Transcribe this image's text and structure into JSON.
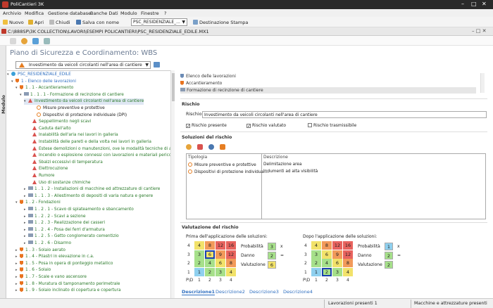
{
  "window": {
    "title": "PoliCantieri 3K",
    "minimize": "–",
    "maximize": "□",
    "close": "✕"
  },
  "menu": [
    "Archivio",
    "Modifica",
    "Gestione database",
    "Banche Dati",
    "Modulo",
    "Finestre",
    "?"
  ],
  "toolbar": {
    "nuovo": "Nuovo",
    "apri": "Apri",
    "chiudi": "Chiudi",
    "salva": "Salva con nome",
    "combo_value": "PSC_RESIDENZIALE_...",
    "stampa": "Destinazione Stampa"
  },
  "path": {
    "text": "C:\\888SP\\3K COLLECTION\\LAVORI\\ESEMPI POLICANTIERI\\PSC_RESIDENZIALE_EDILE.MX1",
    "controls": "– □ ✕"
  },
  "sidebar": {
    "label": "Modulo"
  },
  "page": {
    "title": "Piano di Sicurezza e Coordinamento: WBS"
  },
  "tree_combo": {
    "value": "Investimento da veicoli circolanti nell'area di cantiere"
  },
  "tree": [
    {
      "text": "PSC_RESIDENZIALE_EDILE",
      "color": "blue",
      "icon": "root"
    },
    {
      "text": "1 - Elenco delle lavorazioni",
      "color": "blue",
      "icon": "pin"
    },
    {
      "text": "1 . 1 - Accantieramento",
      "color": "green",
      "icon": "pin"
    },
    {
      "text": "1 . 1 . 1 - Formazione di recinzione di cantiere",
      "color": "green",
      "icon": "folder"
    },
    {
      "text": "Investimento da veicoli circolanti nell'area di cantiere",
      "color": "green",
      "icon": "warn"
    },
    {
      "text": "Misure preventive e protettive",
      "color": "black",
      "icon": "shield"
    },
    {
      "text": "Dispositivi di protezione individuale (DPI)",
      "color": "black",
      "icon": "shield"
    },
    {
      "text": "Seppellimento negli scavi",
      "color": "green",
      "icon": "warn"
    },
    {
      "text": "Caduta dall'alto",
      "color": "green",
      "icon": "warn"
    },
    {
      "text": "Inalabilità dell'aria nei lavori in galleria",
      "color": "green",
      "icon": "warn"
    },
    {
      "text": "Instabilità delle pareti e della volta nei lavori in galleria",
      "color": "green",
      "icon": "warn"
    },
    {
      "text": "Estese demolizioni o manutenzioni, ove le modalità tecniche di atti",
      "color": "green",
      "icon": "warn"
    },
    {
      "text": "Incendio o esplosione connessi con lavorazioni e materiali pericolo",
      "color": "green",
      "icon": "warn"
    },
    {
      "text": "Sbalzi eccessivi di temperatura",
      "color": "green",
      "icon": "warn"
    },
    {
      "text": "Elettrocuzione",
      "color": "green",
      "icon": "warn"
    },
    {
      "text": "Rumore",
      "color": "green",
      "icon": "warn"
    },
    {
      "text": "Uso di sostanze chimiche",
      "color": "green",
      "icon": "warn"
    },
    {
      "text": "1 . 1 . 2 - Installazioni di macchine ed attrezzature di cantiere",
      "color": "green",
      "icon": "folder"
    },
    {
      "text": "1 . 1 . 3 - Allestimento di depositi di varia natura e genere",
      "color": "green",
      "icon": "folder"
    },
    {
      "text": "1 . 2 - Fondazioni",
      "color": "green",
      "icon": "pin"
    },
    {
      "text": "1 . 2 . 1 - Scavo di splateamento e sbancamento",
      "color": "green",
      "icon": "folder"
    },
    {
      "text": "1 . 2 . 2 - Scavi a sezione",
      "color": "green",
      "icon": "folder"
    },
    {
      "text": "1 . 2 . 3 - Realizzazione dei casseri",
      "color": "green",
      "icon": "folder"
    },
    {
      "text": "1 . 2 . 4 - Posa dei ferri d'armatura",
      "color": "green",
      "icon": "folder"
    },
    {
      "text": "1 . 2 . 5 - Getto conglomerato cementizio",
      "color": "green",
      "icon": "folder"
    },
    {
      "text": "1 . 2 . 6 - Disarmo",
      "color": "green",
      "icon": "folder"
    },
    {
      "text": "1 . 3 - Solaio aerato",
      "color": "green",
      "icon": "pin"
    },
    {
      "text": "1 . 4 - Pilastri in elevazione in c.a.",
      "color": "green",
      "icon": "pin"
    },
    {
      "text": "1 . 5 - Posa in opera di ponteggio metallico",
      "color": "green",
      "icon": "pin"
    },
    {
      "text": "1 . 6 - Solaio",
      "color": "green",
      "icon": "pin"
    },
    {
      "text": "1 . 7 - Scale e vano ascensore",
      "color": "green",
      "icon": "pin"
    },
    {
      "text": "1 . 8 - Muratura di tamponamento perimetrale",
      "color": "green",
      "icon": "pin"
    },
    {
      "text": "1 . 9 - Solaio inclinato di copertura e copertura",
      "color": "green",
      "icon": "pin"
    }
  ],
  "breadcrumb_list": [
    "Elenco delle lavorazioni",
    "Accantieramento",
    "Formazione di recinzione di cantiere"
  ],
  "rischio": {
    "section": "Rischio",
    "label": "Rischio:",
    "value": "Investimento da veicoli circolanti nell'area di cantiere",
    "cb_presente": "Rischio presente",
    "cb_valutato": "Rischio valutato",
    "cb_trasmissibile": "Rischio trasmissibile",
    "check_mark": "✓"
  },
  "soluzioni": {
    "section": "Soluzioni del rischio",
    "col_tipologia": "Tipologia",
    "col_descrizione": "Descrizione",
    "rows": [
      {
        "tipologia": "Misure preventive e protettive",
        "descrizione": "Delimitazione area"
      },
      {
        "tipologia": "Dispositivi di protezione individual...",
        "descrizione": "Indumenti ad alta visibilità"
      }
    ]
  },
  "valutazione": {
    "section": "Valutazione del rischio",
    "prima_label": "Prima dell'applicazione delle soluzioni:",
    "dopo_label": "Dopo l'applicazione delle soluzioni:",
    "matrix_values": [
      [
        "4",
        "8",
        "12",
        "16"
      ],
      [
        "3",
        "6",
        "9",
        "12"
      ],
      [
        "2",
        "4",
        "6",
        "8"
      ],
      [
        "1",
        "2",
        "3",
        "4"
      ]
    ],
    "matrix_colors": [
      [
        "#f2e26a",
        "#f29a5a",
        "#e8635e",
        "#e8635e"
      ],
      [
        "#a6e08a",
        "#f2e26a",
        "#f29a5a",
        "#e8635e"
      ],
      [
        "#a6e08a",
        "#a6e08a",
        "#f2e26a",
        "#f29a5a"
      ],
      [
        "#8fd0ef",
        "#a6e08a",
        "#a6e08a",
        "#f2e26a"
      ]
    ],
    "y_axis": [
      "4",
      "3",
      "2",
      "1"
    ],
    "x_axis": [
      "1",
      "2",
      "3",
      "4"
    ],
    "pd_label": "P\\D",
    "prima": {
      "probabilita": "3",
      "danno": "2",
      "valutazione": "6",
      "sel_row": 1,
      "sel_col": 1
    },
    "dopo": {
      "probabilita": "1",
      "danno": "2",
      "valutazione": "2",
      "sel_row": 3,
      "sel_col": 1
    },
    "prob_label": "Probabilità",
    "danno_label": "Danno",
    "val_label": "Valutazione",
    "times": "x",
    "equals": "="
  },
  "tabs": [
    "Descrizione1",
    "Descrizione2",
    "Descrizione3",
    "Descrizione4"
  ],
  "status": {
    "lavorazioni": "Lavorazioni presenti 1",
    "macchine": "Macchine e attrezzature presenti"
  }
}
